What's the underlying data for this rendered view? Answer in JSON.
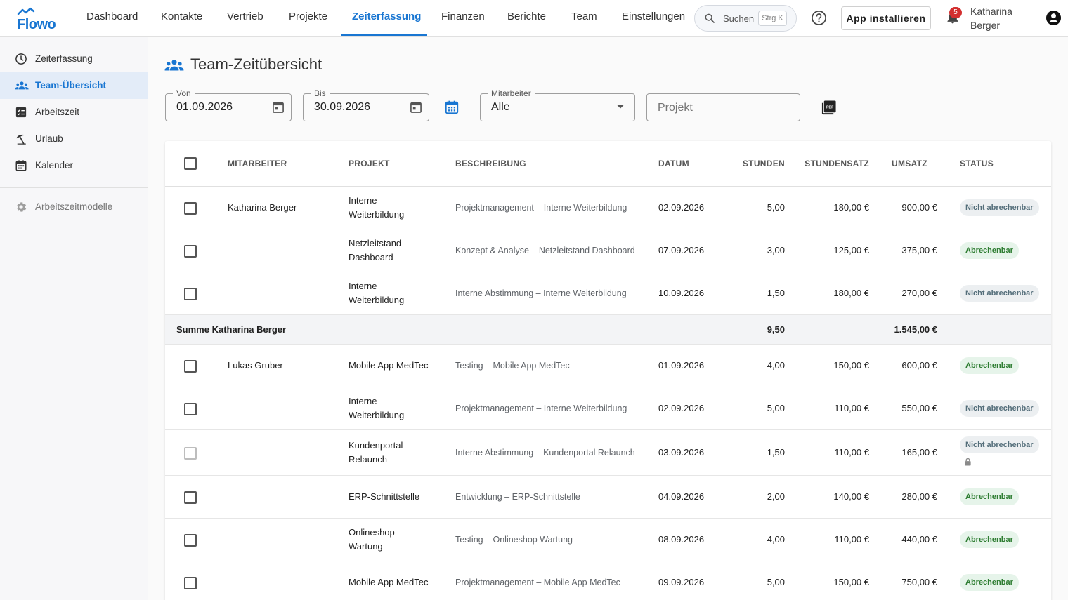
{
  "app": {
    "logo_text": "Flowo"
  },
  "nav": {
    "items": [
      "Dashboard",
      "Kontakte",
      "Vertrieb",
      "Projekte",
      "Zeiterfassung",
      "Finanzen",
      "Berichte",
      "Team",
      "Einstellungen"
    ],
    "active": "Zeiterfassung"
  },
  "search": {
    "label": "Suchen",
    "shortcut": "Strg K"
  },
  "header": {
    "install_label": "App installieren",
    "notification_count": "5",
    "user_first": "Katharina",
    "user_last": "Berger"
  },
  "sidebar": {
    "items": [
      "Zeiterfassung",
      "Team-Übersicht",
      "Arbeitszeit",
      "Urlaub",
      "Kalender"
    ],
    "secondary": "Arbeitszeitmodelle",
    "active": "Team-Übersicht"
  },
  "page": {
    "title": "Team-Zeitübersicht"
  },
  "filters": {
    "from_label": "Von",
    "from_value": "01.09.2026",
    "to_label": "Bis",
    "to_value": "30.09.2026",
    "employee_label": "Mitarbeiter",
    "employee_value": "Alle",
    "project_placeholder": "Projekt"
  },
  "table": {
    "headers": [
      "MITARBEITER",
      "PROJEKT",
      "BESCHREIBUNG",
      "DATUM",
      "STUNDEN",
      "STUNDENSATZ",
      "UMSATZ",
      "STATUS"
    ],
    "rows": [
      {
        "employee": "Katharina Berger",
        "project1": "Interne",
        "project2": "Weiterbildung",
        "description": "Projektmanagement – Interne Weiterbildung",
        "date": "02.09.2026",
        "hours": "5,00",
        "rate": "180,00 €",
        "revenue": "900,00 €",
        "status": "Nicht abrechenbar"
      },
      {
        "employee": "",
        "project1": "Netzleitstand",
        "project2": "Dashboard",
        "description": "Konzept & Analyse – Netzleitstand Dashboard",
        "date": "07.09.2026",
        "hours": "3,00",
        "rate": "125,00 €",
        "revenue": "375,00 €",
        "status": "Abrechenbar"
      },
      {
        "employee": "",
        "project1": "Interne",
        "project2": "Weiterbildung",
        "description": "Interne Abstimmung – Interne Weiterbildung",
        "date": "10.09.2026",
        "hours": "1,50",
        "rate": "180,00 €",
        "revenue": "270,00 €",
        "status": "Nicht abrechenbar"
      },
      {
        "employee": "Lukas Gruber",
        "project1": "Mobile App MedTec",
        "project2": "",
        "description": "Testing – Mobile App MedTec",
        "date": "01.09.2026",
        "hours": "4,00",
        "rate": "150,00 €",
        "revenue": "600,00 €",
        "status": "Abrechenbar"
      },
      {
        "employee": "",
        "project1": "Interne",
        "project2": "Weiterbildung",
        "description": "Projektmanagement – Interne Weiterbildung",
        "date": "02.09.2026",
        "hours": "5,00",
        "rate": "110,00 €",
        "revenue": "550,00 €",
        "status": "Nicht abrechenbar"
      },
      {
        "employee": "",
        "project1": "Kundenportal",
        "project2": "Relaunch",
        "description": "Interne Abstimmung – Kundenportal Relaunch",
        "date": "03.09.2026",
        "hours": "1,50",
        "rate": "110,00 €",
        "revenue": "165,00 €",
        "status": "Nicht abrechenbar"
      },
      {
        "employee": "",
        "project1": "ERP-Schnittstelle",
        "project2": "",
        "description": "Entwicklung – ERP-Schnittstelle",
        "date": "04.09.2026",
        "hours": "2,00",
        "rate": "140,00 €",
        "revenue": "280,00 €",
        "status": "Abrechenbar"
      },
      {
        "employee": "",
        "project1": "Onlineshop",
        "project2": "Wartung",
        "description": "Testing – Onlineshop Wartung",
        "date": "08.09.2026",
        "hours": "4,00",
        "rate": "110,00 €",
        "revenue": "440,00 €",
        "status": "Abrechenbar"
      },
      {
        "employee": "",
        "project1": "Mobile App MedTec",
        "project2": "",
        "description": "Projektmanagement – Mobile App MedTec",
        "date": "09.09.2026",
        "hours": "5,00",
        "rate": "150,00 €",
        "revenue": "750,00 €",
        "status": "Abrechenbar"
      }
    ],
    "sum": {
      "label": "Summe Katharina Berger",
      "hours": "9,50",
      "revenue": "1.545,00 €"
    }
  },
  "colors": {
    "accent": "#1976d2",
    "billable_bg": "#e6f4ea",
    "billable_text": "#2e7d32",
    "nonbillable_bg": "#eceff1",
    "nonbillable_text": "#546e7a",
    "badge_red": "#d32f2f"
  }
}
